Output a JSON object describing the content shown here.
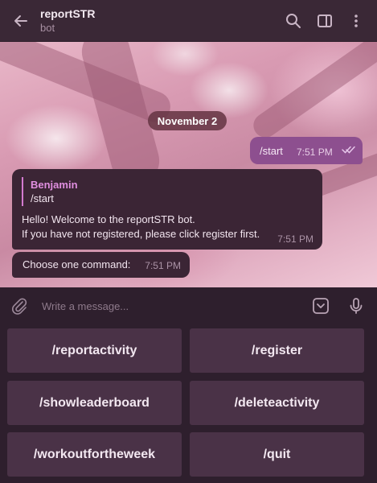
{
  "header": {
    "title": "reportSTR",
    "subtitle": "bot"
  },
  "chat": {
    "date": "November 2",
    "outgoing": {
      "text": "/start",
      "time": "7:51 PM"
    },
    "reply_message": {
      "quote_name": "Benjamin",
      "quote_text": "/start",
      "lines": [
        "Hello! Welcome to the reportSTR bot.",
        "If you have not registered, please click register first."
      ],
      "time": "7:51 PM"
    },
    "second_message": {
      "text": "Choose one command:",
      "time": "7:51 PM"
    }
  },
  "composer": {
    "placeholder": "Write a message..."
  },
  "keyboard": {
    "buttons": [
      "/reportactivity",
      "/register",
      "/showleaderboard",
      "/deleteactivity",
      "/workoutfortheweek",
      "/quit"
    ]
  },
  "colors": {
    "header_bg": "#3a2836",
    "outgoing_bubble": "#8d4f8f",
    "incoming_bubble": "#3b2535",
    "quote_accent": "#e08fe0",
    "keyboard_button": "#4a3247"
  },
  "icons": {
    "back": "back-arrow-icon",
    "search": "search-icon",
    "sidebar": "sidebar-toggle-icon",
    "menu": "more-vertical-icon",
    "attach": "paperclip-icon",
    "keyboard": "bot-keyboard-icon",
    "mic": "microphone-icon",
    "read": "double-check-icon"
  }
}
